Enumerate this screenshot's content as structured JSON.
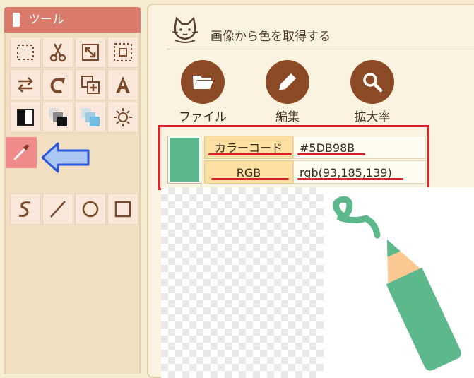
{
  "tool_panel": {
    "title": "ツール"
  },
  "main": {
    "title": "画像から色を取得する",
    "actions": [
      {
        "label": "ファイル",
        "icon": "folder-icon"
      },
      {
        "label": "編集",
        "icon": "pencil-icon"
      },
      {
        "label": "拡大率",
        "icon": "magnifier-icon"
      }
    ],
    "color_info": {
      "swatch_color": "#5DB98B",
      "rows": [
        {
          "label": "カラーコード",
          "value": "#5DB98B"
        },
        {
          "label": "RGB",
          "value": "rgb(93,185,139)"
        }
      ]
    }
  },
  "colors": {
    "accent_header": "#db7b6b",
    "button_brown": "#8b4a25",
    "highlight_red": "#e4212b",
    "picker_active": "#f08b8b"
  }
}
